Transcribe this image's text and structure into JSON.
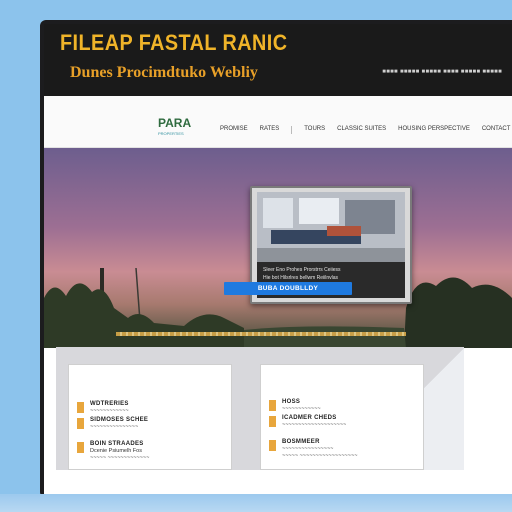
{
  "header": {
    "title": "FILEAP FASTAL RANIC",
    "subtitle": "Dunes Procimdtuko Webliy",
    "top_links": "■■■■ ■■■■■ ■■■■■ ■■■■ ■■■■■ ■■■■■"
  },
  "nav": {
    "logo_mark": "PARA",
    "logo_tag": "PROPERTIES",
    "items": [
      "PROMISE",
      "RATES",
      "TOURS",
      "CLASSIC SUITES",
      "HOUSING PERSPECTIVE",
      "CONTACT"
    ]
  },
  "hero": {
    "caption_lines": [
      "Sleer Eno Prohes Prorstrrs Ceiiess",
      "Hie bot Hilsrlres bellwm Reiilnvlas",
      "Pagnrfiisz ~~~~~~ ~~~~~ ~~~~"
    ],
    "cta_label": "BUBA DOUBLLDY"
  },
  "cards": [
    {
      "rows": [
        {
          "heading": "WDTRERIES",
          "lines": [
            "~~~~~~~~~~~~"
          ]
        },
        {
          "heading": "SIDMOSES SCHEE",
          "lines": [
            "~~~~~~~~~~~~~~~"
          ]
        },
        {
          "heading": "BOIN STRAADES",
          "lines": [
            "Dcenie Psiumelh Fos",
            "~~~~~ ~~~~~~~~~~~~~"
          ]
        }
      ]
    },
    {
      "rows": [
        {
          "heading": "HOSS",
          "lines": [
            "~~~~~~~~~~~~"
          ]
        },
        {
          "heading": "ICADMER CHEDS",
          "lines": [
            "~~~~~~~~~~~~~~~~~~~~"
          ]
        },
        {
          "heading": "BOSMMEER",
          "lines": [
            "~~~~~~~~~~~~~~~~",
            "~~~~~ ~~~~~~~~~~~~~~~~~~"
          ]
        }
      ]
    }
  ],
  "colors": {
    "brand": "#f0b429",
    "cta": "#1f7ae0",
    "bullet": "#e8a63c",
    "topbar": "#1a1a1a"
  }
}
